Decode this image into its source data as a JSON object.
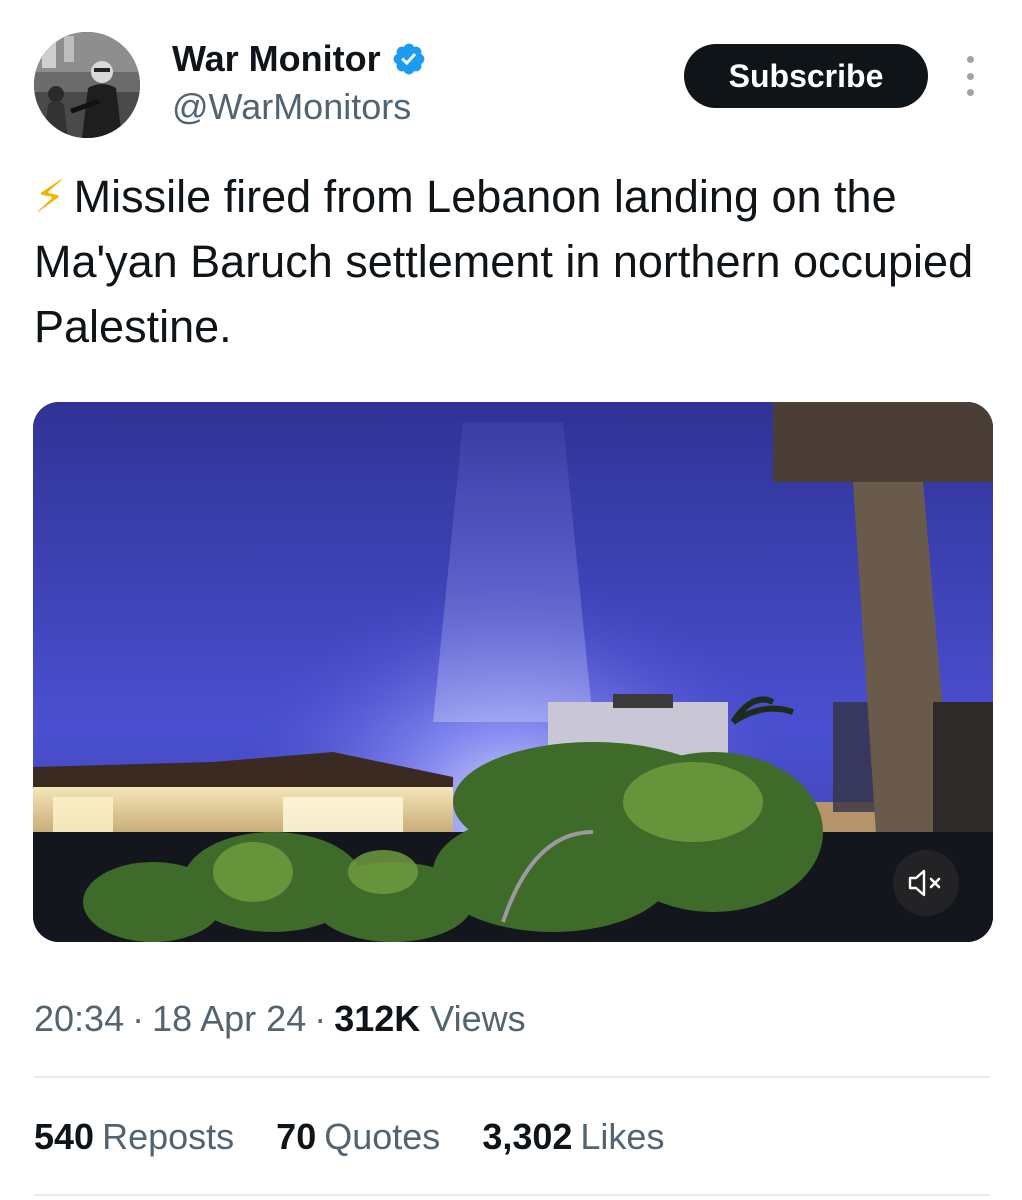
{
  "author": {
    "name": "War Monitor",
    "handle": "@WarMonitors",
    "verified": true,
    "avatar_icon": "avatar-photo"
  },
  "actions": {
    "subscribe_label": "Subscribe",
    "more_icon": "more-vertical-icon"
  },
  "tweet": {
    "emoji": "⚡",
    "text": "Missile fired from Lebanon landing on the Ma'yan Baruch settlement in northern occupied Palestine."
  },
  "media": {
    "type": "video",
    "mute_icon": "speaker-muted-icon"
  },
  "meta": {
    "time": "20:34",
    "separator": "·",
    "date": "18 Apr 24",
    "views_count": "312K",
    "views_label": "Views"
  },
  "stats": [
    {
      "count": "540",
      "label": "Reposts"
    },
    {
      "count": "70",
      "label": "Quotes"
    },
    {
      "count": "3,302",
      "label": "Likes"
    }
  ],
  "colors": {
    "primary_text": "#0f1419",
    "secondary_text": "#536471",
    "verified_blue": "#1d9bf0",
    "button_bg": "#0f1419",
    "divider": "#e6ecf0"
  }
}
